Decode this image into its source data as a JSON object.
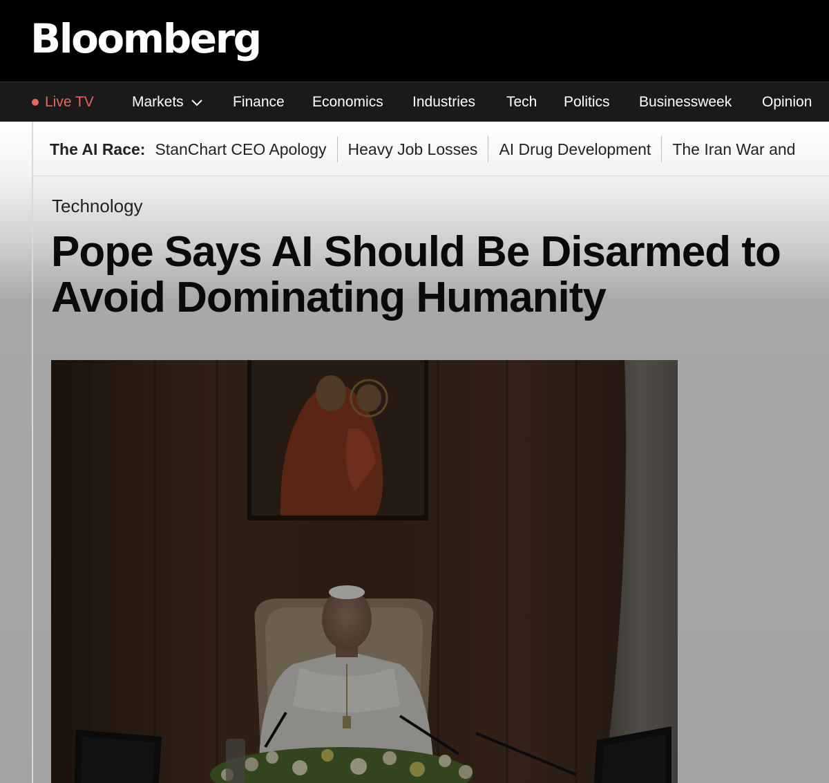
{
  "brand": {
    "logo_text": "Bloomberg"
  },
  "nav": {
    "live_tv": "Live TV",
    "items": [
      "Markets",
      "Finance",
      "Economics",
      "Industries",
      "Tech",
      "Politics",
      "Businessweek",
      "Opinion"
    ]
  },
  "ticker": {
    "label": "The AI Race:",
    "links": [
      "StanChart CEO Apology",
      "Heavy Job Losses",
      "AI Drug Development",
      "The Iran War and"
    ]
  },
  "article": {
    "section": "Technology",
    "headline": "Pope Says AI Should Be Disarmed to Avoid Dominating Humanity"
  },
  "colors": {
    "live_accent": "#e8675a",
    "masthead": "#000000",
    "nav_bg": "#1a1a1a"
  },
  "icons": {
    "markets_dropdown": "chevron-down-icon",
    "live": "live-dot-icon"
  }
}
